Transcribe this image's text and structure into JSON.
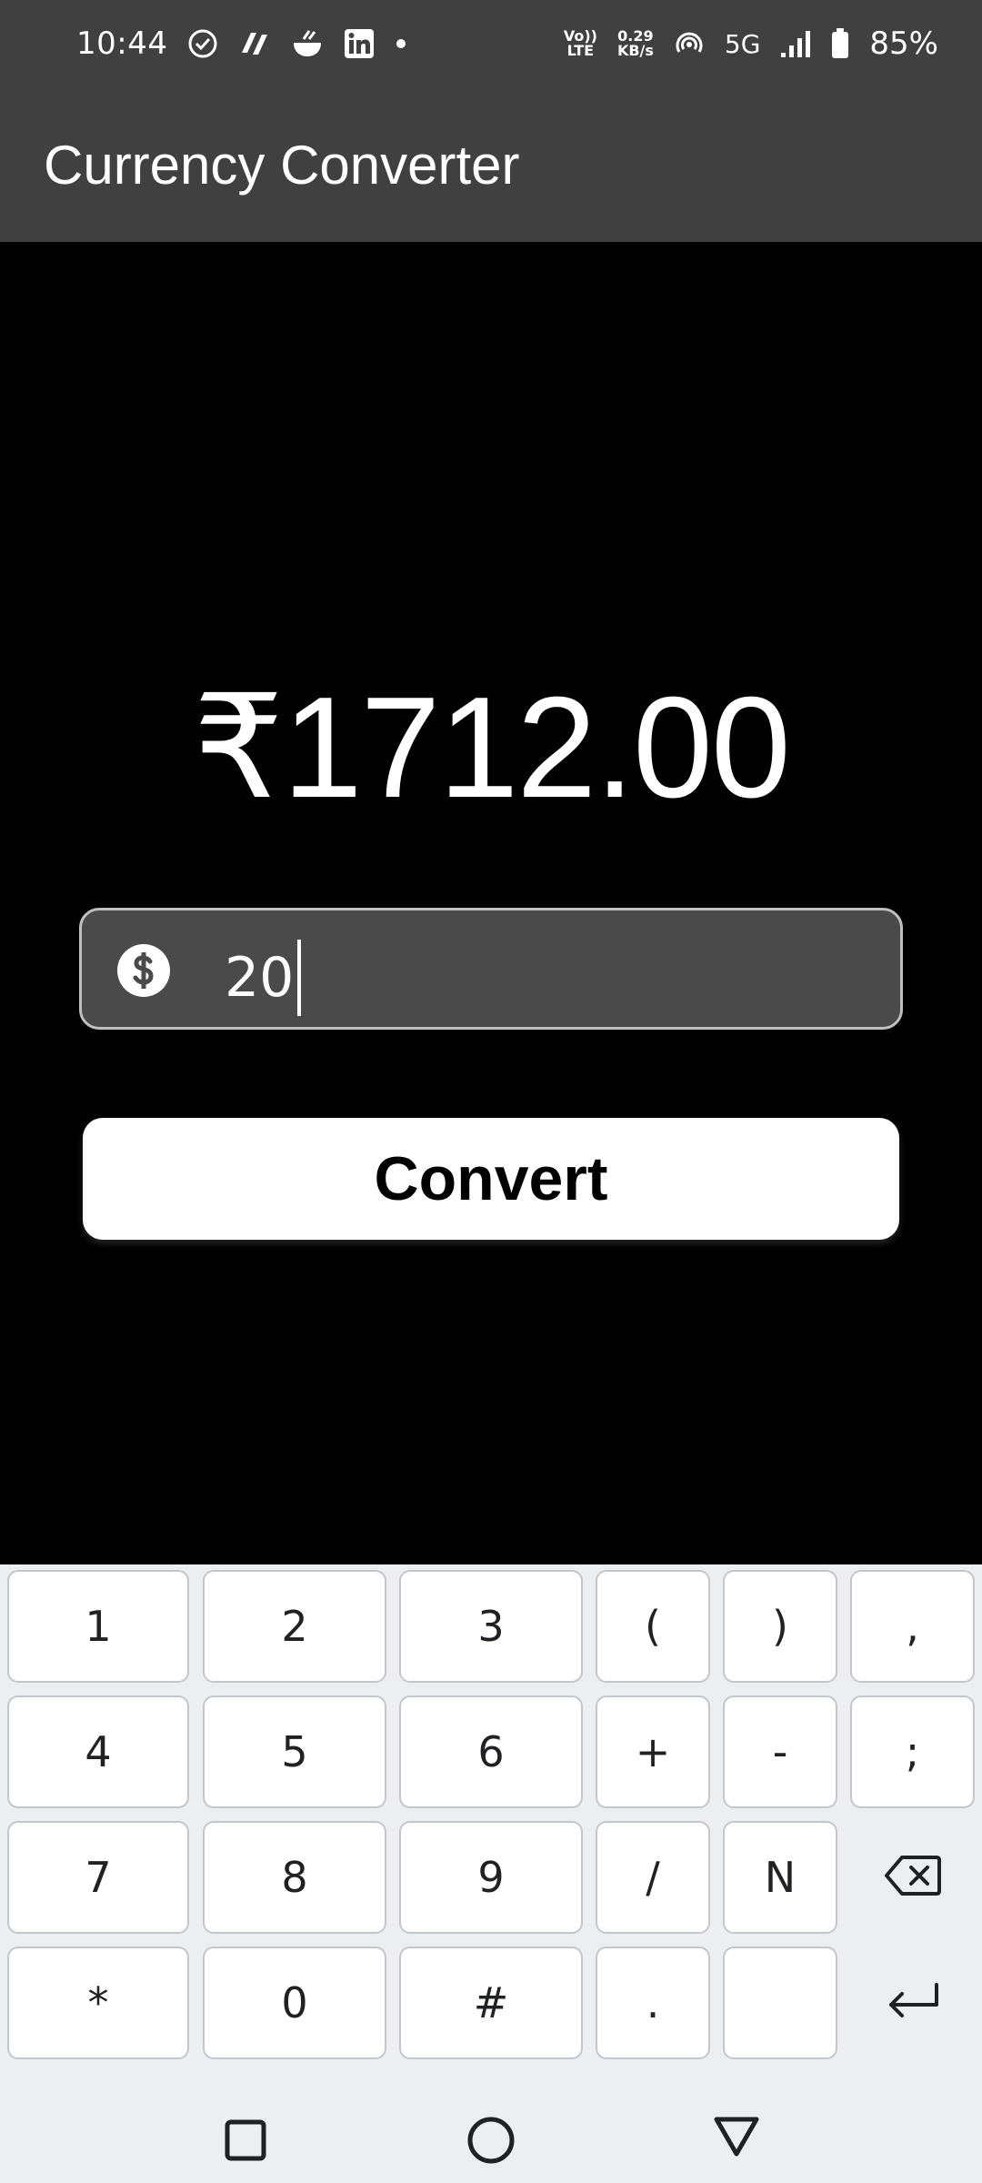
{
  "status_bar": {
    "time": "10:44",
    "network_speed_value": "0.29",
    "network_speed_unit": "KB/s",
    "volte_top": "Vo))",
    "volte_bottom": "LTE",
    "network_type": "5G",
    "battery_percent": "85%",
    "notification_icons": [
      "check-circle-icon",
      "app-icon",
      "food-bowl-icon",
      "linkedin-icon",
      "dot-icon"
    ]
  },
  "app_bar": {
    "title": "Currency Converter"
  },
  "result": {
    "text": "₹1712.00"
  },
  "amount_input": {
    "value": "20",
    "icon": "dollar-icon"
  },
  "convert_button": {
    "label": "Convert"
  },
  "keyboard": {
    "row1": [
      "1",
      "2",
      "3",
      "(",
      ")",
      ","
    ],
    "row2": [
      "4",
      "5",
      "6",
      "+",
      "-",
      ";"
    ],
    "row3": [
      "7",
      "8",
      "9",
      "/",
      "N"
    ],
    "row4": [
      "*",
      "0",
      "#",
      ".",
      ""
    ],
    "function_keys": [
      "backspace-icon",
      "enter-icon"
    ]
  },
  "nav_bar": {
    "buttons": [
      "recents-icon",
      "home-icon",
      "back-icon"
    ]
  },
  "colors": {
    "app_bar": "#404040",
    "background": "#000000",
    "input_fill": "#4a4a4a",
    "button_fill": "#ffffff",
    "keyboard_bg": "#eceef1"
  }
}
